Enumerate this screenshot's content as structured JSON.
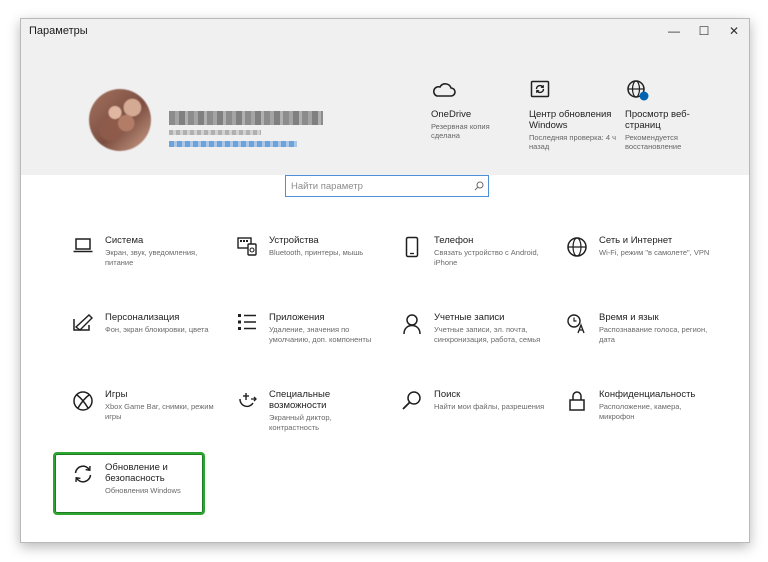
{
  "window": {
    "title": "Параметры",
    "controls": {
      "minimize": "—",
      "maximize": "☐",
      "close": "✕"
    }
  },
  "quick_links": [
    {
      "title": "OneDrive",
      "subtitle": "Резервная копия сделана",
      "icon": "cloud-icon"
    },
    {
      "title": "Центр обновления Windows",
      "subtitle": "Последняя проверка: 4 ч назад",
      "icon": "update-center-icon"
    },
    {
      "title": "Просмотр веб-страниц",
      "subtitle": "Рекомендуется восстановление",
      "icon": "globe-icon"
    }
  ],
  "search": {
    "placeholder": "Найти параметр"
  },
  "categories": [
    {
      "title": "Система",
      "subtitle": "Экран, звук, уведомления, питание",
      "icon": "laptop-icon"
    },
    {
      "title": "Устройства",
      "subtitle": "Bluetooth, принтеры, мышь",
      "icon": "devices-icon"
    },
    {
      "title": "Телефон",
      "subtitle": "Связать устройство с Android, iPhone",
      "icon": "phone-icon"
    },
    {
      "title": "Сеть и Интернет",
      "subtitle": "Wi-Fi, режим \"в самолете\", VPN",
      "icon": "globe-icon"
    },
    {
      "title": "Персонализация",
      "subtitle": "Фон, экран блокировки, цвета",
      "icon": "personalization-icon"
    },
    {
      "title": "Приложения",
      "subtitle": "Удаление, значения по умолчанию, доп. компоненты",
      "icon": "apps-list-icon"
    },
    {
      "title": "Учетные записи",
      "subtitle": "Учетные записи, эл. почта, синхронизация, работа, семья",
      "icon": "person-icon"
    },
    {
      "title": "Время и язык",
      "subtitle": "Распознавание голоса, регион, дата",
      "icon": "time-language-icon"
    },
    {
      "title": "Игры",
      "subtitle": "Xbox Game Bar, снимки, режим игры",
      "icon": "xbox-icon"
    },
    {
      "title": "Специальные возможности",
      "subtitle": "Экранный диктор, контрастность",
      "icon": "accessibility-icon"
    },
    {
      "title": "Поиск",
      "subtitle": "Найти мои файлы, разрешения",
      "icon": "search-icon"
    },
    {
      "title": "Конфиденциальность",
      "subtitle": "Расположение, камера, микрофон",
      "icon": "lock-icon"
    },
    {
      "title": "Обновление и безопасность",
      "subtitle": "Обновления Windows",
      "icon": "sync-icon"
    }
  ],
  "colors": {
    "accent": "#0063b1",
    "highlight_border": "#2fa531",
    "header_bg": "#f0f0f0"
  }
}
